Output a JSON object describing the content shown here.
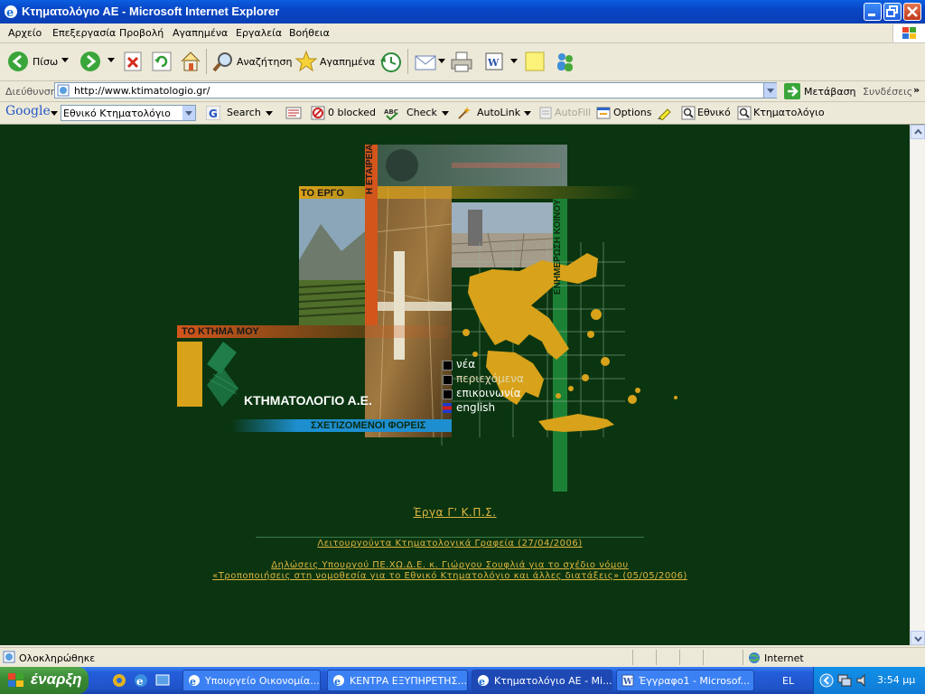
{
  "window": {
    "title": "Κτηματολόγιο ΑΕ - Microsoft Internet Explorer"
  },
  "menu": [
    "Αρχείο",
    "Επεξεργασία",
    "Προβολή",
    "Αγαπημένα",
    "Εργαλεία",
    "Βοήθεια"
  ],
  "toolbar": {
    "back": "Πίσω",
    "search": "Αναζήτηση",
    "favorites": "Αγαπημένα"
  },
  "address": {
    "label": "Διεύθυνση",
    "url": "http://www.ktimatologio.gr/",
    "go": "Μετάβαση",
    "links": "Συνδέσεις"
  },
  "googlebar": {
    "logo": "Google",
    "query": "Εθνικό Κτηματολόγιο",
    "search": "Search",
    "blocked": "0 blocked",
    "check": "Check",
    "autolink": "AutoLink",
    "autofill": "AutoFill",
    "options": "Options",
    "term1": "Εθνικό",
    "term2": "Κτηματολόγιο"
  },
  "page": {
    "to_ergo": "ΤΟ ΕΡΓΟ",
    "h_etaireia": "Η ΕΤΑΙΡΕΙΑ",
    "enimerosi": "ΕΝΗΜΕΡΩΣΗ ΚΟΙΝΟΥ",
    "to_ktima": "ΤΟ ΚΤΗΜΑ ΜΟΥ",
    "logo_text": "ΚΤΗΜΑΤΟΛΟΓΙΟ Α.Ε.",
    "foreis": "ΣΧΕΤΙΖΟΜΕΝΟΙ ΦΟΡΕΙΣ",
    "nav": [
      "νέα",
      "περιεχόμενα",
      "επικοινωνία",
      "english"
    ],
    "link_main": "Έργα Γ' Κ.Π.Σ.",
    "link_offices": "Λειτουργούντα Κτηματολογικά Γραφεία (27/04/2006)",
    "link_decl_1": "Δηλώσεις Υπουργού ΠΕ.ΧΩ.Δ.Ε. κ. Γιώργου Σουφλιά για το σχέδιο νόμου",
    "link_decl_2": "«Τροποποιήσεις στη νομοθεσία για το Εθνικό Κτηματολόγιο και άλλες διατάξεις» (05/05/2006)"
  },
  "status": {
    "text": "Ολοκληρώθηκε",
    "zone": "Internet"
  },
  "taskbar": {
    "start": "έναρξη",
    "tasks": [
      "Υπουργείο Οικονομία...",
      "ΚΕΝΤΡΑ ΕΞΥΠΗΡΕΤΗΣ...",
      "Κτηματολόγιο ΑΕ - Mi...",
      "Έγγραφο1 - Microsof..."
    ],
    "lang": "EL",
    "clock": "3:54 μμ"
  },
  "colors": {
    "page_bg": "#0a3510",
    "gold": "#d8a21a",
    "orange": "#d2561c",
    "blue": "#1d8fd0",
    "green": "#1f8a3a",
    "link": "#e0b640"
  }
}
